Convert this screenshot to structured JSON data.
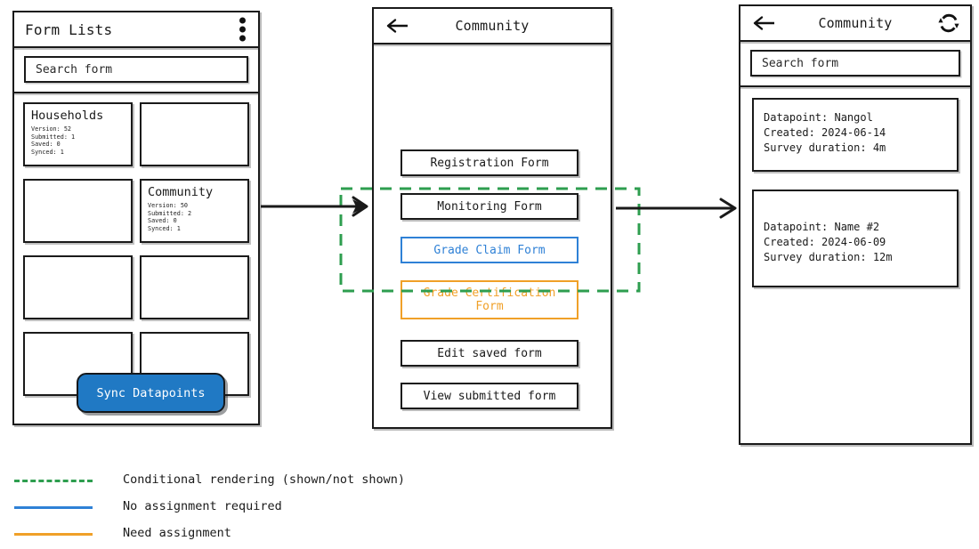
{
  "colors": {
    "ink": "#1a1a1a",
    "accent_blue": "#2f81d6",
    "accent_orange": "#f0a028",
    "conditional_green": "#2e9e4f",
    "fab_blue": "#2079c4"
  },
  "panel_form_lists": {
    "title": "Form Lists",
    "menu_icon": "more-vertical-icon",
    "search": {
      "placeholder": "Search form",
      "value": "Search form"
    },
    "cards": [
      {
        "title": "Households",
        "version_label": "Version: 52",
        "submitted_label": "Submitted: 1",
        "saved_label": "Saved: 0",
        "synced_label": "Synced: 1",
        "empty": false
      },
      {
        "title": "",
        "version_label": "",
        "submitted_label": "",
        "saved_label": "",
        "synced_label": "",
        "empty": true
      },
      {
        "title": "",
        "version_label": "",
        "submitted_label": "",
        "saved_label": "",
        "synced_label": "",
        "empty": true
      },
      {
        "title": "Community",
        "version_label": "Version: 50",
        "submitted_label": "Submitted: 2",
        "saved_label": "Saved: 0",
        "synced_label": "Synced: 1",
        "empty": false
      },
      {
        "title": "",
        "version_label": "",
        "submitted_label": "",
        "saved_label": "",
        "synced_label": "",
        "empty": true
      },
      {
        "title": "",
        "version_label": "",
        "submitted_label": "",
        "saved_label": "",
        "synced_label": "",
        "empty": true
      },
      {
        "title": "",
        "version_label": "",
        "submitted_label": "",
        "saved_label": "",
        "synced_label": "",
        "empty": true
      },
      {
        "title": "",
        "version_label": "",
        "submitted_label": "",
        "saved_label": "",
        "synced_label": "",
        "empty": true
      }
    ],
    "sync_button": {
      "label": "Sync Datapoints"
    }
  },
  "panel_community_forms": {
    "title": "Community",
    "back_icon": "arrow-left-icon",
    "buttons": [
      {
        "label": "Registration Form",
        "style": "default"
      },
      {
        "label": "Monitoring Form",
        "style": "default"
      },
      {
        "label": "Grade Claim Form",
        "style": "blue"
      },
      {
        "label": "Grade Certification\nForm",
        "style": "orange"
      },
      {
        "label": "Edit saved form",
        "style": "default"
      },
      {
        "label": "View submitted form",
        "style": "default"
      }
    ]
  },
  "panel_community_datapoints": {
    "title": "Community",
    "back_icon": "arrow-left-icon",
    "refresh_icon": "refresh-sync-icon",
    "search": {
      "placeholder": "Search form",
      "value": "Search form"
    },
    "datapoints": [
      {
        "name_line": "Datapoint: Nangol",
        "created_line": "Created: 2024-06-14",
        "duration_line": "Survey duration: 4m"
      },
      {
        "name_line": "Datapoint: Name #2",
        "created_line": "Created: 2024-06-09",
        "duration_line": "Survey duration: 12m"
      }
    ]
  },
  "legend": {
    "items": [
      {
        "label": "Conditional rendering (shown/not shown)",
        "style": "dashed-green"
      },
      {
        "label": "No assignment required",
        "style": "solid-blue"
      },
      {
        "label": "Need assignment",
        "style": "solid-orange"
      }
    ]
  }
}
